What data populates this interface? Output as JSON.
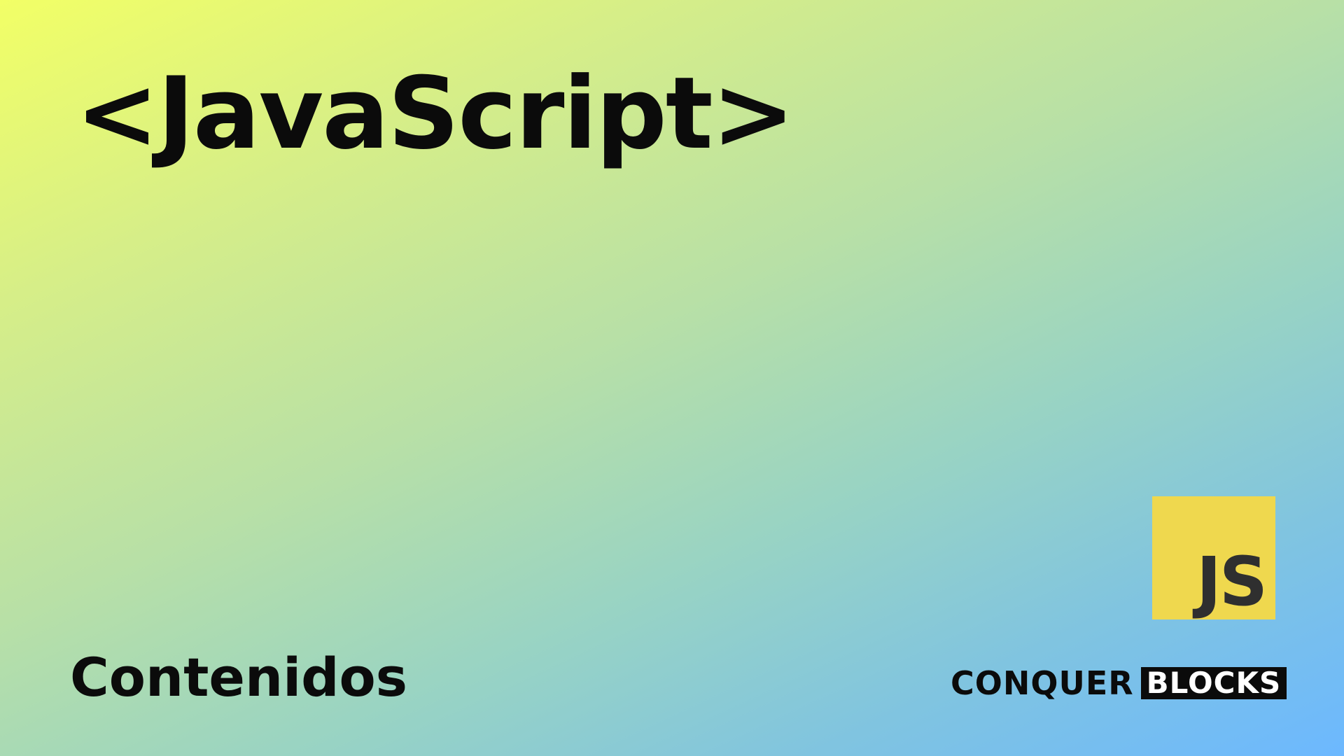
{
  "title": {
    "open_bracket": "<",
    "text": "JavaScript",
    "close_bracket": ">"
  },
  "subtitle": "Contenidos",
  "js_badge": {
    "text": "JS",
    "background": "#efd84e",
    "text_color": "#2f2f2f"
  },
  "brand": {
    "word_1": "CONQUER",
    "word_2": "BLOCKS"
  },
  "colors": {
    "gradient_start": "#f2ff66",
    "gradient_end": "#6cb8ff",
    "text": "#0b0b0b"
  }
}
